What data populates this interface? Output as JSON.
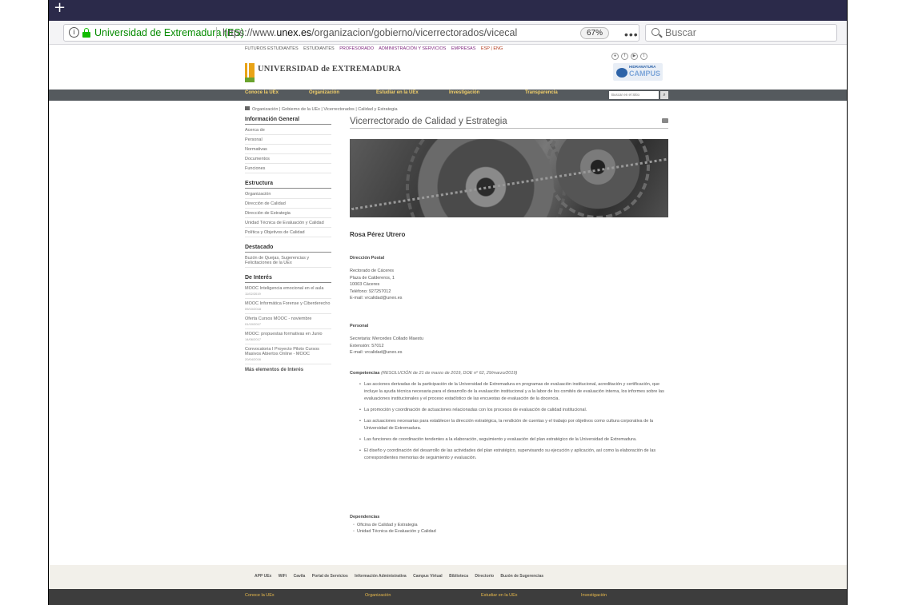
{
  "browser": {
    "new_tab": "+",
    "site_identity": "Universidad de Extremadura (ES)",
    "url_prefix": "https://www.",
    "url_domain": "unex.es",
    "url_path": "/organizacion/gobierno/vicerrectorados/vicecal",
    "zoom": "67%",
    "more": "•••",
    "search_placeholder": "Buscar"
  },
  "toplinks": {
    "futuros": "FUTUROS ESTUDIANTES",
    "estudiantes": "ESTUDIANTES",
    "profesorado": "PROFESORADO",
    "admin": "ADMINISTRACIÓN Y SERVICIOS",
    "empresas": "EMPRESAS",
    "lang": "ESP | ENG"
  },
  "brand": {
    "name": "UNIVERSIDAD de EXTREMADURA",
    "badge_top": "HIDRAMATURA",
    "badge_bottom": "CAMPUS"
  },
  "mainnav": {
    "items": [
      "Conoce la UEx",
      "Organización",
      "Estudiar en la UEx",
      "Investigación",
      "Transparencia"
    ],
    "search_placeholder": "Buscar en el Sitio"
  },
  "breadcrumb": "Organización | Gobierno de la UEx | Vicerrectorados | Calidad y Estrategia",
  "sidebar": {
    "info_head": "Información General",
    "info_items": [
      "Acerca de",
      "Personal",
      "Normativas",
      "Documentos",
      "Funciones"
    ],
    "estructura_head": "Estructura",
    "estructura_items": [
      "Organización",
      "Dirección de Calidad",
      "Dirección de Estrategia",
      "Unidad Técnica de Evaluación y Calidad",
      "Política y Objetivos de Calidad"
    ],
    "destacado_head": "Destacado",
    "destacado_items": [
      "Buzón de Quejas, Sugerencias y Felicitaciones de la UEx"
    ],
    "interes_head": "De Interés",
    "interes_items": [
      {
        "label": "MOOC Inteligencia emocional en el aula",
        "date": "11/02/2019"
      },
      {
        "label": "MOOC Informática Forense y Ciberderecho",
        "date": "09/10/2018"
      },
      {
        "label": "Oferta Cursos MOOC - noviembre",
        "date": "01/10/2017"
      },
      {
        "label": "MOOC: propuestas formativas en Junio",
        "date": "14/06/2017"
      },
      {
        "label": "Convocatoria I Proyecto Piloto Cursos Masivos Abiertos Online - MOOC",
        "date": "20/04/2016"
      }
    ],
    "more": "Más elementos de Interés"
  },
  "main": {
    "title": "Vicerrectorado de Calidad y Estrategia",
    "person": "Rosa Pérez Utrero",
    "postal_head": "Dirección Postal",
    "postal_lines": [
      "Rectorado de Cáceres",
      "Plaza de Caldereros, 1",
      "10003 Cáceres",
      "Teléfono: 927257012",
      "E-mail: vrcalidad@unex.es"
    ],
    "personal_head": "Personal",
    "personal_lines": [
      "Secretaria: Mercedes Collado Maestu",
      "Extensión: 57012",
      "E-mail: vrcalidad@unex.es"
    ],
    "comp_head": "Competencias",
    "comp_ref": "(RESOLUCIÓN de 21 de marzo de 2019, DOE nº 62, 29/marzo/2019)",
    "comp_items": [
      "Las acciones derivadas de la participación de la Universidad de Extremadura en programas de evaluación institucional, acreditación y certificación, que incluye la ayuda técnica necesaria para el desarrollo de la evaluación institucional y a la labor de los comités de evaluación interna, los informes sobre las evaluaciones institucionales y el proceso estadístico de las encuestas de evaluación de la docencia.",
      "La promoción y coordinación de actuaciones relacionadas con los procesos de evaluación de calidad institucional.",
      "Las actuaciones necesarias para establecer la dirección estratégica, la rendición de cuentas y el trabajo por objetivos como cultura corporativa de la Universidad de Extremadura.",
      "Las funciones de coordinación tendentes a la elaboración, seguimiento y evaluación del plan estratégico de la Universidad de Extremadura.",
      "El diseño y coordinación del desarrollo de las actividades del plan estratégico, supervisando su ejecución y aplicación, así como la elaboración de las correspondientes memorias de seguimiento y evaluación."
    ],
    "deps_head": "Dependencias",
    "deps_items": [
      "Oficina de Calidad y Estrategia",
      "Unidad Técnica de Evaluación y Calidad"
    ]
  },
  "footer": {
    "links": [
      "APP UEx",
      "WiFi",
      "Cavila",
      "Portal de Servicios",
      "Información Administrativa",
      "Campus Virtual",
      "Biblioteca",
      "Directorio",
      "Buzón de Sugerencias"
    ],
    "nav": [
      "Conoce la UEx",
      "Organización",
      "Estudiar en la UEx",
      "Investigación"
    ]
  },
  "colors": {
    "tabbar": "#2b2a4a",
    "nav_bg": "#555a5e",
    "nav_text": "#f3d06a",
    "secure_green": "#058b00"
  }
}
